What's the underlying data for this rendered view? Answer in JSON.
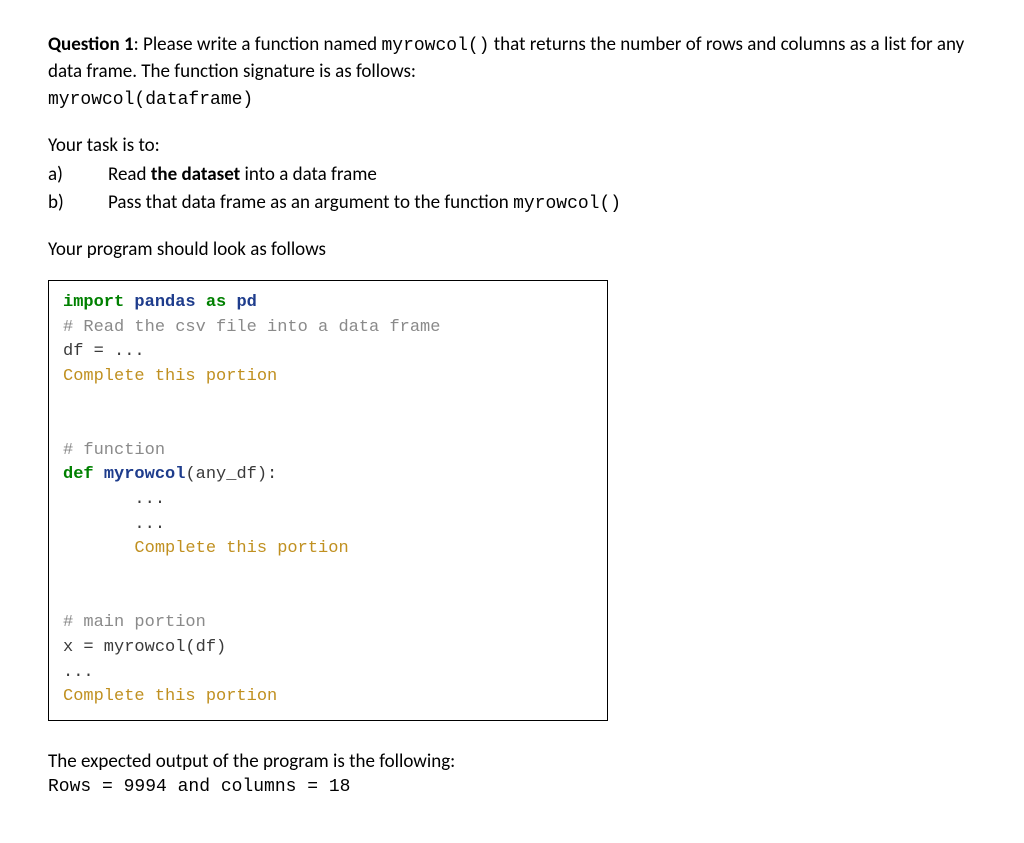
{
  "question": {
    "label": "Question 1",
    "intro_part1": ": Please write a function named ",
    "func_name": "myrowcol()",
    "intro_part2": " that returns the number of rows and columns as a list for any data frame. The function signature is as follows:",
    "signature": "myrowcol(dataframe)"
  },
  "task": {
    "heading": "Your task is to:",
    "items": [
      {
        "label": "a)",
        "text_pre": "Read ",
        "bold": "the dataset",
        "text_post": " into a data frame",
        "mono": ""
      },
      {
        "label": "b)",
        "text_pre": "Pass that data frame as an argument to the function ",
        "bold": "",
        "text_post": "",
        "mono": "myrowcol()"
      }
    ]
  },
  "follows": "Your program should look as follows",
  "code": {
    "line1_kw": "import",
    "line1_mod": "pandas",
    "line1_as": "as",
    "line1_alias": "pd",
    "line2": "# Read the csv file into a data frame",
    "line3": "df = ...",
    "line4": "Complete this portion",
    "line5": "# function",
    "line6_def": "def",
    "line6_name": "myrowcol",
    "line6_rest": "(any_df):",
    "line7": "       ...",
    "line8": "       ...",
    "line9": "       Complete this portion",
    "line10": "# main portion",
    "line11": "x = myrowcol(df)",
    "line12": "...",
    "line13": "Complete this portion"
  },
  "expected": {
    "intro": "The expected output of the program is the following:",
    "output": "Rows = 9994 and columns = 18"
  }
}
